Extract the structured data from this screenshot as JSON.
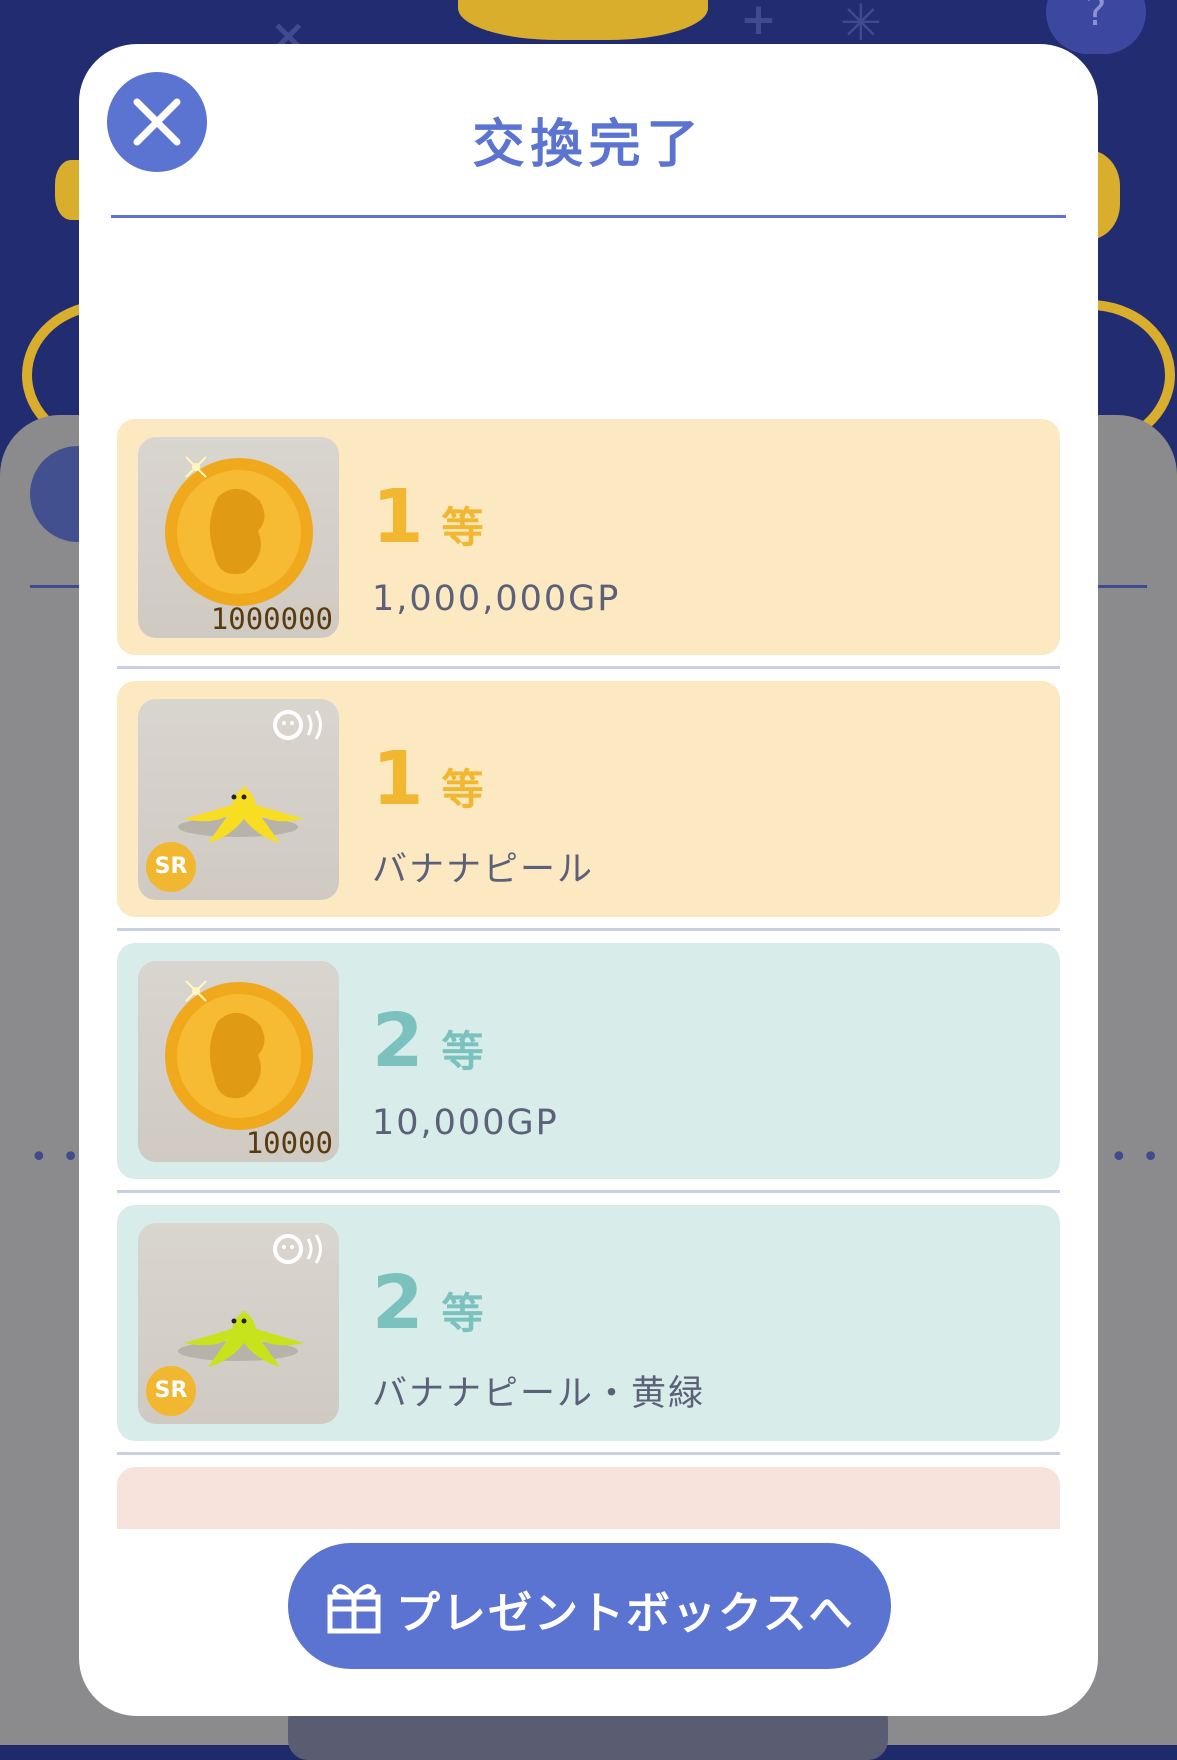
{
  "modal": {
    "title": "交換完了",
    "present_button_label": "プレゼントボックスへ"
  },
  "rewards": [
    {
      "rank_number": "1",
      "rank_suffix": "等",
      "name": "1,000,000GP",
      "quantity": "1000000",
      "item_type": "gold-coin",
      "tier": "gold"
    },
    {
      "rank_number": "1",
      "rank_suffix": "等",
      "name": "バナナピール",
      "badge": "SR",
      "item_type": "banana-peel",
      "tier": "gold"
    },
    {
      "rank_number": "2",
      "rank_suffix": "等",
      "name": "10,000GP",
      "quantity": "10000",
      "item_type": "gold-coin",
      "tier": "teal"
    },
    {
      "rank_number": "2",
      "rank_suffix": "等",
      "name": "バナナピール・黄緑",
      "badge": "SR",
      "item_type": "banana-peel-yellow-green",
      "tier": "teal"
    }
  ],
  "background": {
    "help_icon": "?"
  },
  "colors": {
    "accent": "#5b74d1",
    "gold_row": "#fce8c1",
    "teal_row": "#d8ecea",
    "gold_rank": "#f2b730",
    "teal_rank": "#7bc2bf"
  }
}
